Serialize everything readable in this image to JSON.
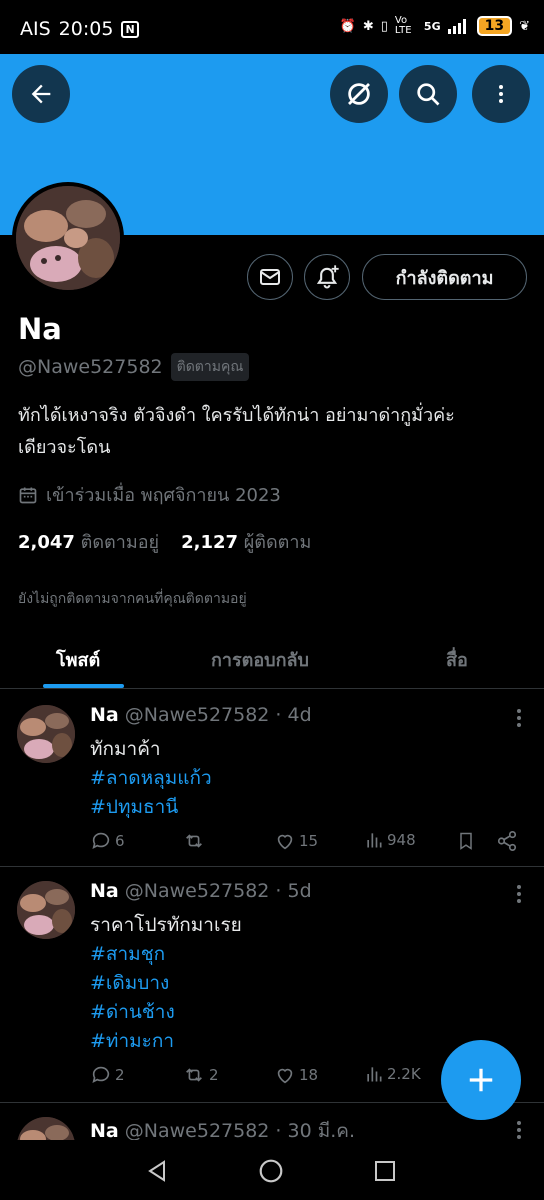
{
  "status_bar": {
    "carrier": "AIS",
    "time": "20:05",
    "network": "5G",
    "volte": "Vo LTE",
    "battery": "13"
  },
  "profile": {
    "name": "Na",
    "handle": "@Nawe527582",
    "follows_you": "ติดตามคุณ",
    "bio_line1": "ทักได้เหงาจริง ตัวจิงดำ ใครรับได้ทักน่า อย่ามาด่ากูมั่วค่ะ",
    "bio_line2": "เดียวจะโดน",
    "joined": "เข้าร่วมเมื่อ พฤศจิกายน 2023",
    "following_count": "2,047",
    "following_label": "ติดตามอยู่",
    "followers_count": "2,127",
    "followers_label": "ผู้ติดตาม",
    "not_followed_note": "ยังไม่ถูกติดตามจากคนที่คุณติดตามอยู่",
    "follow_button": "กำลังติดตาม"
  },
  "tabs": [
    {
      "label": "โพสต์",
      "active": true
    },
    {
      "label": "การตอบกลับ",
      "active": false
    },
    {
      "label": "สื่อ",
      "active": false
    }
  ],
  "tweets": [
    {
      "name": "Na",
      "meta": "@Nawe527582 · 4d",
      "lines": [
        "ทักมาค้า"
      ],
      "tags": [
        "#ลาดหลุมแก้ว",
        "#ปทุมธานี"
      ],
      "replies": "6",
      "retweets": "",
      "likes": "15",
      "views": "948"
    },
    {
      "name": "Na",
      "meta": "@Nawe527582 · 5d",
      "lines": [
        "ราคาโปรทักมาเรย"
      ],
      "tags": [
        "#สามชุก",
        "#เดิมบาง",
        "#ด่านช้าง",
        "#ท่ามะกา"
      ],
      "replies": "2",
      "retweets": "2",
      "likes": "18",
      "views": "2.2K"
    },
    {
      "name": "Na",
      "meta": "@Nawe527582 · 30 มี.ค."
    }
  ],
  "colors": {
    "accent": "#1d9bf0",
    "background": "#000000",
    "secondary_text": "#71767b"
  }
}
